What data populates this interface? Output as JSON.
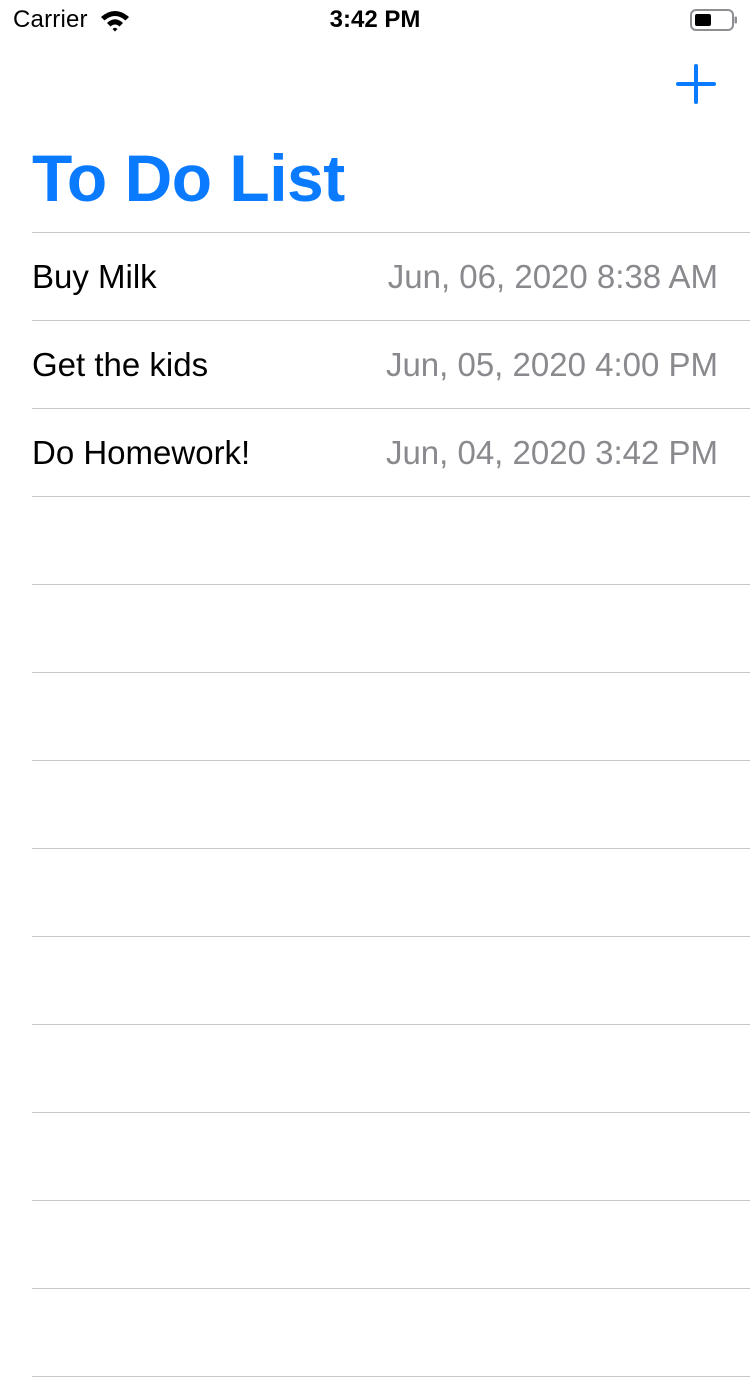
{
  "colors": {
    "accent": "#0a7aff",
    "detail_text": "#8a8a8e",
    "separator": "#c8c8cc"
  },
  "status_bar": {
    "carrier": "Carrier",
    "time": "3:42 PM",
    "icons": [
      "wifi-icon",
      "battery-icon"
    ]
  },
  "nav": {
    "add_icon": "plus-icon",
    "title": "To Do List"
  },
  "todos": [
    {
      "title": "Buy Milk",
      "date": "Jun, 06, 2020 8:38 AM"
    },
    {
      "title": "Get the kids",
      "date": "Jun, 05, 2020 4:00 PM"
    },
    {
      "title": "Do Homework!",
      "date": "Jun, 04, 2020 3:42 PM"
    }
  ]
}
